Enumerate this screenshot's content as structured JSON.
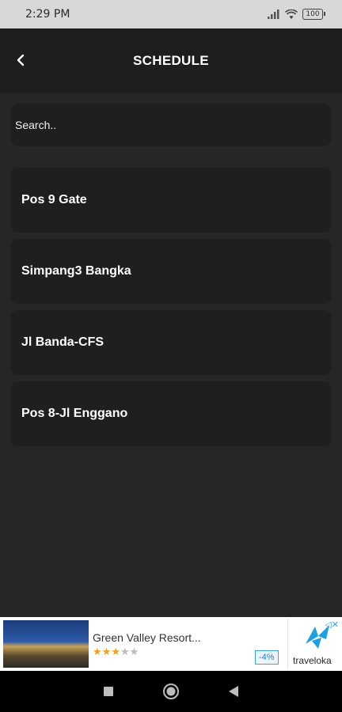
{
  "status_bar": {
    "time": "2:29 PM",
    "battery": "100"
  },
  "header": {
    "title": "SCHEDULE",
    "back_icon": "chevron-left-icon"
  },
  "search": {
    "placeholder": "Search.."
  },
  "schedule_items": [
    {
      "label": "Pos 9 Gate"
    },
    {
      "label": "Simpang3 Bangka"
    },
    {
      "label": "Jl Banda-CFS"
    },
    {
      "label": "Pos 8-Jl Enggano"
    }
  ],
  "ad": {
    "title": "Green Valley Resort...",
    "rating": 3,
    "rating_max": 5,
    "discount": "-4%",
    "brand": "traveloka"
  },
  "nav_bar": {
    "icons": [
      "square-icon",
      "circle-home-icon",
      "triangle-back-icon"
    ]
  },
  "colors": {
    "background": "#262626",
    "card": "#1f1f1f",
    "header": "#1e1e1e",
    "text": "#ffffff"
  }
}
